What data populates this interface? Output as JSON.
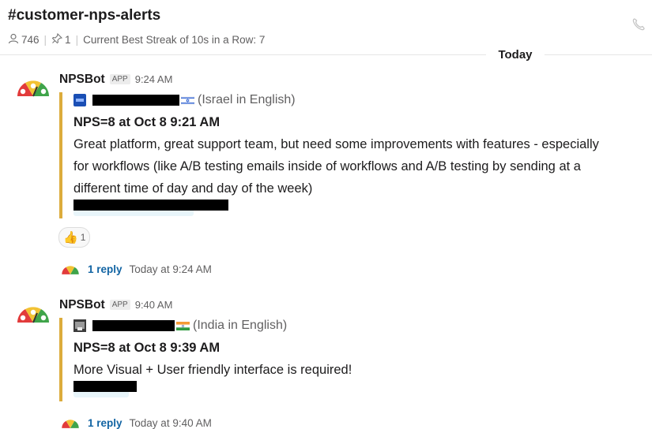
{
  "channel": {
    "name": "#customer-nps-alerts",
    "member_count": "746",
    "pinned_count": "1",
    "topic": "Current Best Streak of 10s in a Row: 7"
  },
  "divider": {
    "label": "Today"
  },
  "messages": [
    {
      "sender": "NPSBot",
      "badge": "APP",
      "time": "9:24 AM",
      "author_suffix": "(Israel in English)",
      "nps": "NPS=8 at Oct 8 9:21 AM",
      "body": "Great platform, great support team, but need some improvements with features - especially for workflows (like A/B testing emails inside of workflows and A/B testing by sending at a different time of day and day of the week)",
      "reaction": {
        "emoji": "👍",
        "count": "1"
      },
      "reply_label": "1 reply",
      "reply_time": "Today at 9:24 AM"
    },
    {
      "sender": "NPSBot",
      "badge": "APP",
      "time": "9:40 AM",
      "author_suffix": "(India in English)",
      "nps": "NPS=8 at Oct 8 9:39 AM",
      "body": "More Visual + User friendly interface is required!",
      "reply_label": "1 reply",
      "reply_time": "Today at 9:40 AM"
    }
  ],
  "colors": {
    "attachment_bar": "#dcac3c",
    "link": "#1264a3",
    "muted": "#616061"
  }
}
